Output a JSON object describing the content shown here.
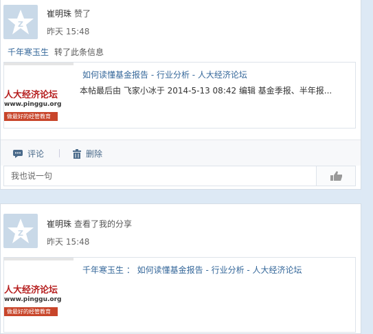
{
  "feed": [
    {
      "user": "崔明珠",
      "action": "赞了",
      "time": "昨天 15:48",
      "repost": {
        "user": "千年寒玉生",
        "text": "转了此条信息"
      },
      "share": {
        "title": "如何读懂基金报告 - 行业分析 - 人大经济论坛",
        "excerpt": "本帖最后由 飞家小冰于 2014-5-13 08:42 编辑 基金季报、半年报...",
        "thumb_title": "人大经济论坛",
        "thumb_url": "www.pinggu.org",
        "thumb_slogan": "做最好的经管教育"
      },
      "toolbar": {
        "comment_label": "评论",
        "delete_label": "删除"
      },
      "reply_placeholder": "我也说一句"
    },
    {
      "user": "崔明珠",
      "action": "查看了我的分享",
      "time": "昨天 15:48",
      "share": {
        "title": "千年寒玉生 ： 如何读懂基金报告 - 行业分析 - 人大经济论坛",
        "thumb_title": "人大经济论坛",
        "thumb_url": "www.pinggu.org",
        "thumb_slogan": "做最好的经管教育"
      }
    }
  ],
  "colors": {
    "page_background": "#dde9f5",
    "link": "#336699",
    "avatar_bg": "#c9d9e8",
    "thumb_red": "#b51d1d"
  },
  "icons": {
    "avatar": "default-avatar-star-icon",
    "comment": "comment-bubble-icon",
    "delete": "trash-icon",
    "like": "thumbs-up-icon"
  }
}
